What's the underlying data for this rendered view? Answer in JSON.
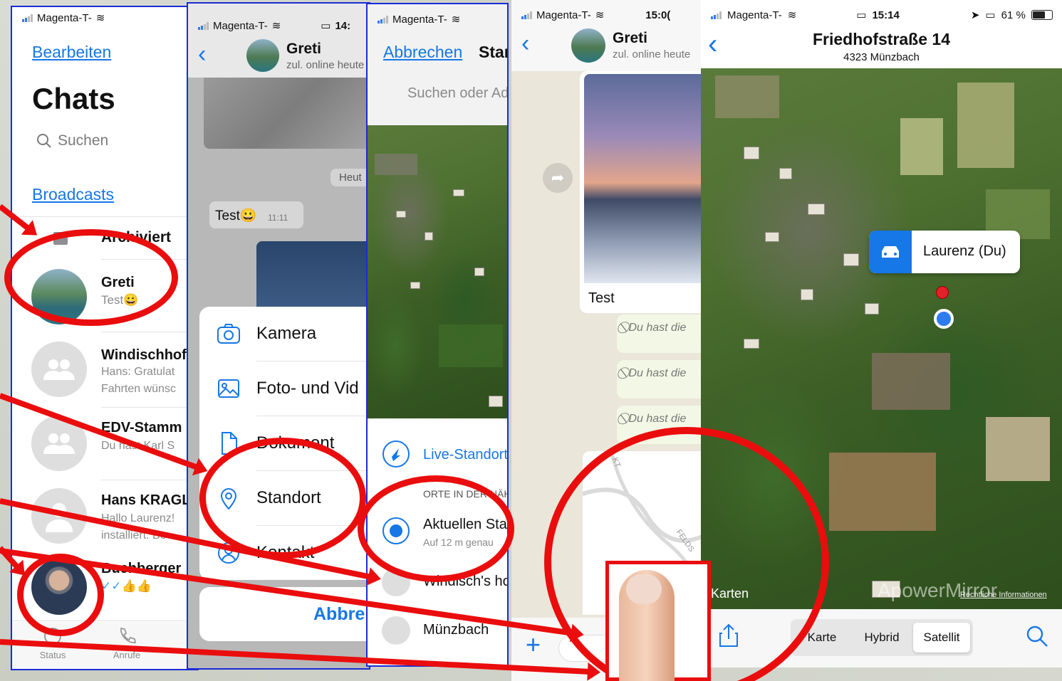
{
  "status": {
    "carrier": "Magenta-T-",
    "time1": "14:",
    "time2": "15:0(",
    "time3": "15:14",
    "battery": "61 %"
  },
  "p1": {
    "edit": "Bearbeiten",
    "title": "Chats",
    "search": "Suchen",
    "broadcasts": "Broadcasts",
    "archived": "Archiviert",
    "chats": [
      {
        "name": "Greti",
        "preview": "Test😀"
      },
      {
        "name": "Windischhof",
        "preview1": "Hans: Gratulat",
        "preview2": "Fahrten wünsc"
      },
      {
        "name": "EDV-Stamm",
        "preview": "Du hast Karl S"
      },
      {
        "name": "Hans KRAGL",
        "preview1": "Hallo Laurenz!",
        "preview2": "installiert. Be"
      },
      {
        "name": "Buchberger",
        "preview": "✓✓👍👍"
      }
    ],
    "tabs": [
      "Status",
      "Anrufe"
    ]
  },
  "p2": {
    "name": "Greti",
    "status": "zul. online heute",
    "today": "Heut",
    "msg": "Test😀",
    "msg_time": "11:11",
    "menu": [
      "Kamera",
      "Foto- und Vid",
      "Dokument",
      "Standort",
      "Kontakt"
    ],
    "cancel": "Abbre"
  },
  "p3": {
    "cancel": "Abbrechen",
    "title_part": "Star",
    "search": "Suchen oder Ad",
    "live": "Live-Standort",
    "nearby": "ORTE IN DER NÄH",
    "current": "Aktuellen Sta",
    "accuracy": "Auf 12 m genau",
    "place1": "Windisch's ho",
    "place2": "Münzbach"
  },
  "p4": {
    "name": "Greti",
    "status": "zul. online heute",
    "caption": "Test",
    "deleted": "Du hast die",
    "map_label1": "KT",
    "map_label2": "FELDS"
  },
  "p5": {
    "street": "Friedhofstraße 14",
    "city": "4323 Münzbach",
    "pin_label": "Laurenz (Du)",
    "maps_brand": "Karten",
    "legal": "Rechtliche Informationen",
    "watermark": "ApowerMirror",
    "seg": [
      "Karte",
      "Hybrid",
      "Satellit"
    ]
  },
  "colors": {
    "accent": "#1677e6",
    "marker": "#ea0d0d",
    "frame": "#1b2bd6"
  }
}
